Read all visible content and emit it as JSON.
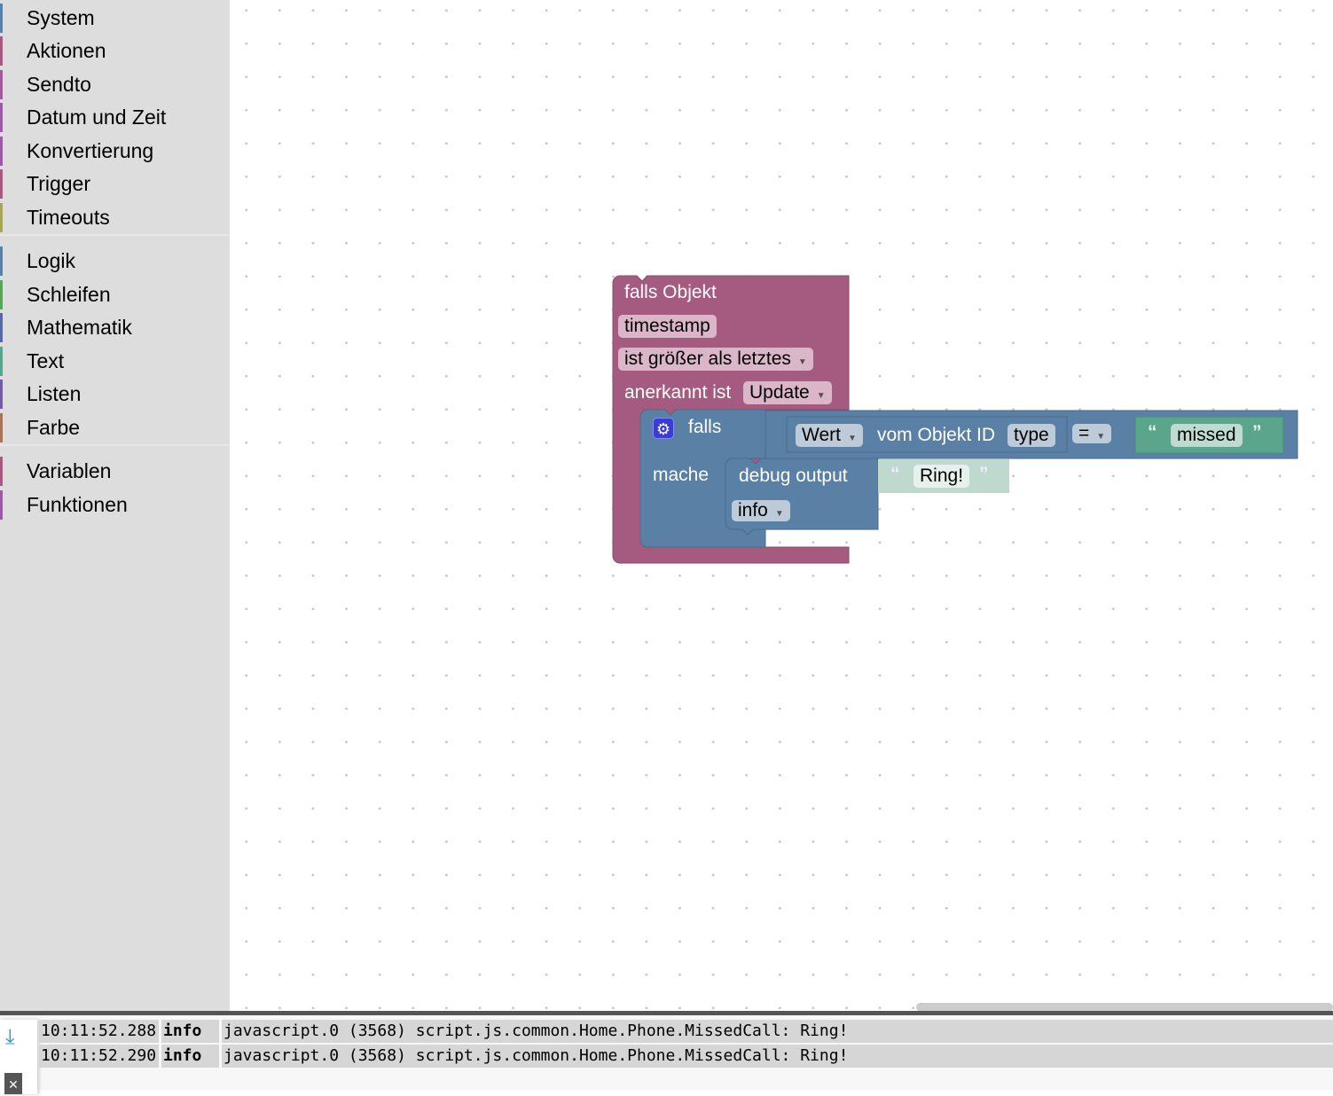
{
  "sidebar": {
    "groups": [
      [
        {
          "label": "System",
          "color": "#5b80a5"
        },
        {
          "label": "Aktionen",
          "color": "#a55b80"
        },
        {
          "label": "Sendto",
          "color": "#a55b99"
        },
        {
          "label": "Datum und Zeit",
          "color": "#995ba5"
        },
        {
          "label": "Konvertierung",
          "color": "#995ba5"
        },
        {
          "label": "Trigger",
          "color": "#a55b80"
        },
        {
          "label": "Timeouts",
          "color": "#a5a55b"
        }
      ],
      [
        {
          "label": "Logik",
          "color": "#5b80a5"
        },
        {
          "label": "Schleifen",
          "color": "#5ba55b"
        },
        {
          "label": "Mathematik",
          "color": "#5b67a5"
        },
        {
          "label": "Text",
          "color": "#5ba58c"
        },
        {
          "label": "Listen",
          "color": "#745ba5"
        },
        {
          "label": "Farbe",
          "color": "#a5745b"
        }
      ],
      [
        {
          "label": "Variablen",
          "color": "#a55b80"
        },
        {
          "label": "Funktionen",
          "color": "#995ba5"
        }
      ]
    ]
  },
  "blocks": {
    "trigger": {
      "title": "falls Objekt",
      "object": "timestamp",
      "condition": "ist größer als letztes",
      "ack_label": "anerkannt ist",
      "ack_value": "Update",
      "color": "#a55b80"
    },
    "if": {
      "label_if": "falls",
      "label_do": "mache",
      "color": "#5b80a5",
      "icon": "gear-icon"
    },
    "compare": {
      "prop": "Wert",
      "of_label": "vom Objekt ID",
      "object": "type",
      "operator": "=",
      "value": "missed"
    },
    "debug": {
      "label": "debug output",
      "level": "info",
      "text": "Ring!"
    },
    "quote_open": "“",
    "quote_close": "”"
  },
  "log": {
    "rows": [
      {
        "time": "10:11:52.288",
        "level": "info",
        "message": "javascript.0 (3568) script.js.common.Home.Phone.MissedCall: Ring!"
      },
      {
        "time": "10:11:52.290",
        "level": "info",
        "message": "javascript.0 (3568) script.js.common.Home.Phone.MissedCall: Ring!"
      }
    ]
  }
}
